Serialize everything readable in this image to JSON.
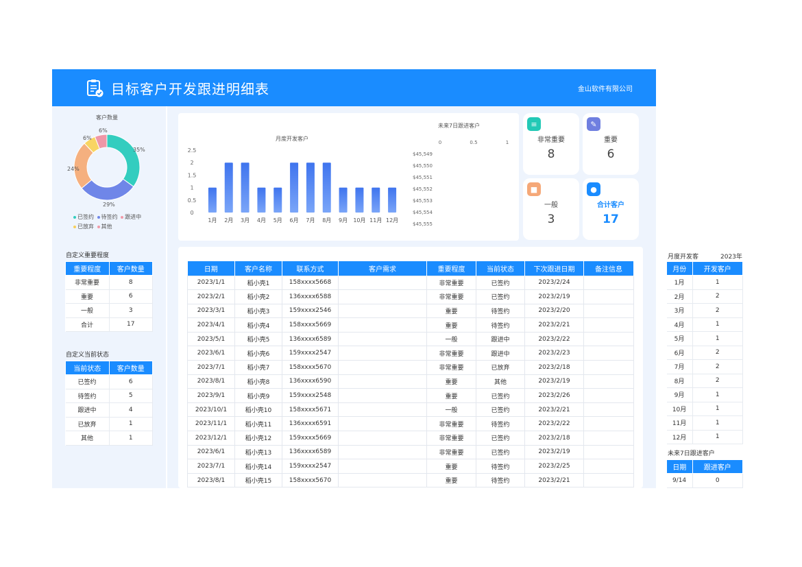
{
  "header": {
    "title": "目标客户开发跟进明细表",
    "company": "金山软件有限公司"
  },
  "donut": {
    "title": "客户数量",
    "labels": [
      "35%",
      "29%",
      "24%",
      "6%",
      "6%"
    ],
    "legend": [
      {
        "label": "已签约",
        "color": "#33cdbf"
      },
      {
        "label": "待签约",
        "color": "#6f86e8"
      },
      {
        "label": "跟进中",
        "color": "#f19aa8"
      },
      {
        "label": "已放弃",
        "color": "#f8cf5a"
      },
      {
        "label": "其他",
        "color": "#f19aa8"
      }
    ]
  },
  "importance": {
    "title": "自定义重要程度",
    "headers": [
      "重要程度",
      "客户数量"
    ],
    "rows": [
      [
        "非常重要",
        "8"
      ],
      [
        "重要",
        "6"
      ],
      [
        "一般",
        "3"
      ],
      [
        "合计",
        "17"
      ]
    ]
  },
  "status": {
    "title": "自定义当前状态",
    "headers": [
      "当前状态",
      "客户数量"
    ],
    "rows": [
      [
        "已签约",
        "6"
      ],
      [
        "待签约",
        "5"
      ],
      [
        "跟进中",
        "4"
      ],
      [
        "已放弃",
        "1"
      ],
      [
        "其他",
        "1"
      ]
    ]
  },
  "chart_data": [
    {
      "type": "bar",
      "title": "月度开发客户",
      "categories": [
        "1月",
        "2月",
        "3月",
        "4月",
        "5月",
        "6月",
        "7月",
        "8月",
        "9月",
        "10月",
        "11月",
        "12月"
      ],
      "values": [
        1,
        2,
        2,
        1,
        1,
        2,
        2,
        2,
        1,
        1,
        1,
        1
      ],
      "ylim": [
        0,
        2.5
      ],
      "yticks": [
        "2.5",
        "2",
        "1.5",
        "1",
        "0.5",
        "0"
      ],
      "grid": false,
      "color": "#4a7df0"
    },
    {
      "type": "bar",
      "title": "未来7日跟进客户",
      "xticks": [
        "0",
        "0.5",
        "1"
      ],
      "categories": [
        "$45,549",
        "$45,550",
        "$45,551",
        "$45,552",
        "$45,553",
        "$45,554",
        "$45,555"
      ],
      "values": [
        0,
        0,
        0,
        0,
        0,
        0,
        0
      ]
    }
  ],
  "stats": [
    {
      "label": "非常重要",
      "value": "8",
      "color": "#23c9b6"
    },
    {
      "label": "重要",
      "value": "6",
      "color": "#6f7fe0"
    },
    {
      "label": "一般",
      "value": "3",
      "color": "#f5a878"
    },
    {
      "label": "合计客户",
      "value": "17",
      "color": "#1a8cff"
    }
  ],
  "main_table": {
    "headers": [
      "日期",
      "客户名称",
      "联系方式",
      "客户需求",
      "重要程度",
      "当前状态",
      "下次跟进日期",
      "备注信息"
    ],
    "rows": [
      [
        "2023/1/1",
        "稻小壳1",
        "158xxxx5668",
        "",
        "非常重要",
        "已签约",
        "2023/2/24",
        ""
      ],
      [
        "2023/2/1",
        "稻小壳2",
        "136xxxx6588",
        "",
        "非常重要",
        "已签约",
        "2023/2/19",
        ""
      ],
      [
        "2023/3/1",
        "稻小壳3",
        "159xxxx2546",
        "",
        "重要",
        "待签约",
        "2023/2/20",
        ""
      ],
      [
        "2023/4/1",
        "稻小壳4",
        "158xxxx5669",
        "",
        "重要",
        "待签约",
        "2023/2/21",
        ""
      ],
      [
        "2023/5/1",
        "稻小壳5",
        "136xxxx6589",
        "",
        "一般",
        "跟进中",
        "2023/2/22",
        ""
      ],
      [
        "2023/6/1",
        "稻小壳6",
        "159xxxx2547",
        "",
        "非常重要",
        "跟进中",
        "2023/2/23",
        ""
      ],
      [
        "2023/7/1",
        "稻小壳7",
        "158xxxx5670",
        "",
        "非常重要",
        "已放弃",
        "2023/2/18",
        ""
      ],
      [
        "2023/8/1",
        "稻小壳8",
        "136xxxx6590",
        "",
        "重要",
        "其他",
        "2023/2/19",
        ""
      ],
      [
        "2023/9/1",
        "稻小壳9",
        "159xxxx2548",
        "",
        "重要",
        "已签约",
        "2023/2/26",
        ""
      ],
      [
        "2023/10/1",
        "稻小壳10",
        "158xxxx5671",
        "",
        "一般",
        "已签约",
        "2023/2/21",
        ""
      ],
      [
        "2023/11/1",
        "稻小壳11",
        "136xxxx6591",
        "",
        "非常重要",
        "待签约",
        "2023/2/22",
        ""
      ],
      [
        "2023/12/1",
        "稻小壳12",
        "159xxxx5669",
        "",
        "非常重要",
        "已签约",
        "2023/2/18",
        ""
      ],
      [
        "2023/6/1",
        "稻小壳13",
        "136xxxx6589",
        "",
        "非常重要",
        "已签约",
        "2023/2/19",
        ""
      ],
      [
        "2023/7/1",
        "稻小壳14",
        "159xxxx2547",
        "",
        "重要",
        "待签约",
        "2023/2/25",
        ""
      ],
      [
        "2023/8/1",
        "稻小壳15",
        "158xxxx5670",
        "",
        "重要",
        "待签约",
        "2023/2/21",
        ""
      ]
    ]
  },
  "right_panel": {
    "title": "月度开发客",
    "year": "2023年",
    "headers": [
      "月份",
      "开发客户"
    ],
    "rows": [
      [
        "1月",
        "1"
      ],
      [
        "2月",
        "2"
      ],
      [
        "3月",
        "2"
      ],
      [
        "4月",
        "1"
      ],
      [
        "5月",
        "1"
      ],
      [
        "6月",
        "2"
      ],
      [
        "7月",
        "2"
      ],
      [
        "8月",
        "2"
      ],
      [
        "9月",
        "1"
      ],
      [
        "10月",
        "1"
      ],
      [
        "11月",
        "1"
      ],
      [
        "12月",
        "1"
      ]
    ],
    "followup_title": "未来7日跟进客户",
    "followup_headers": [
      "日期",
      "跟进客户"
    ],
    "followup_rows": [
      [
        "9/14",
        "0"
      ]
    ]
  }
}
